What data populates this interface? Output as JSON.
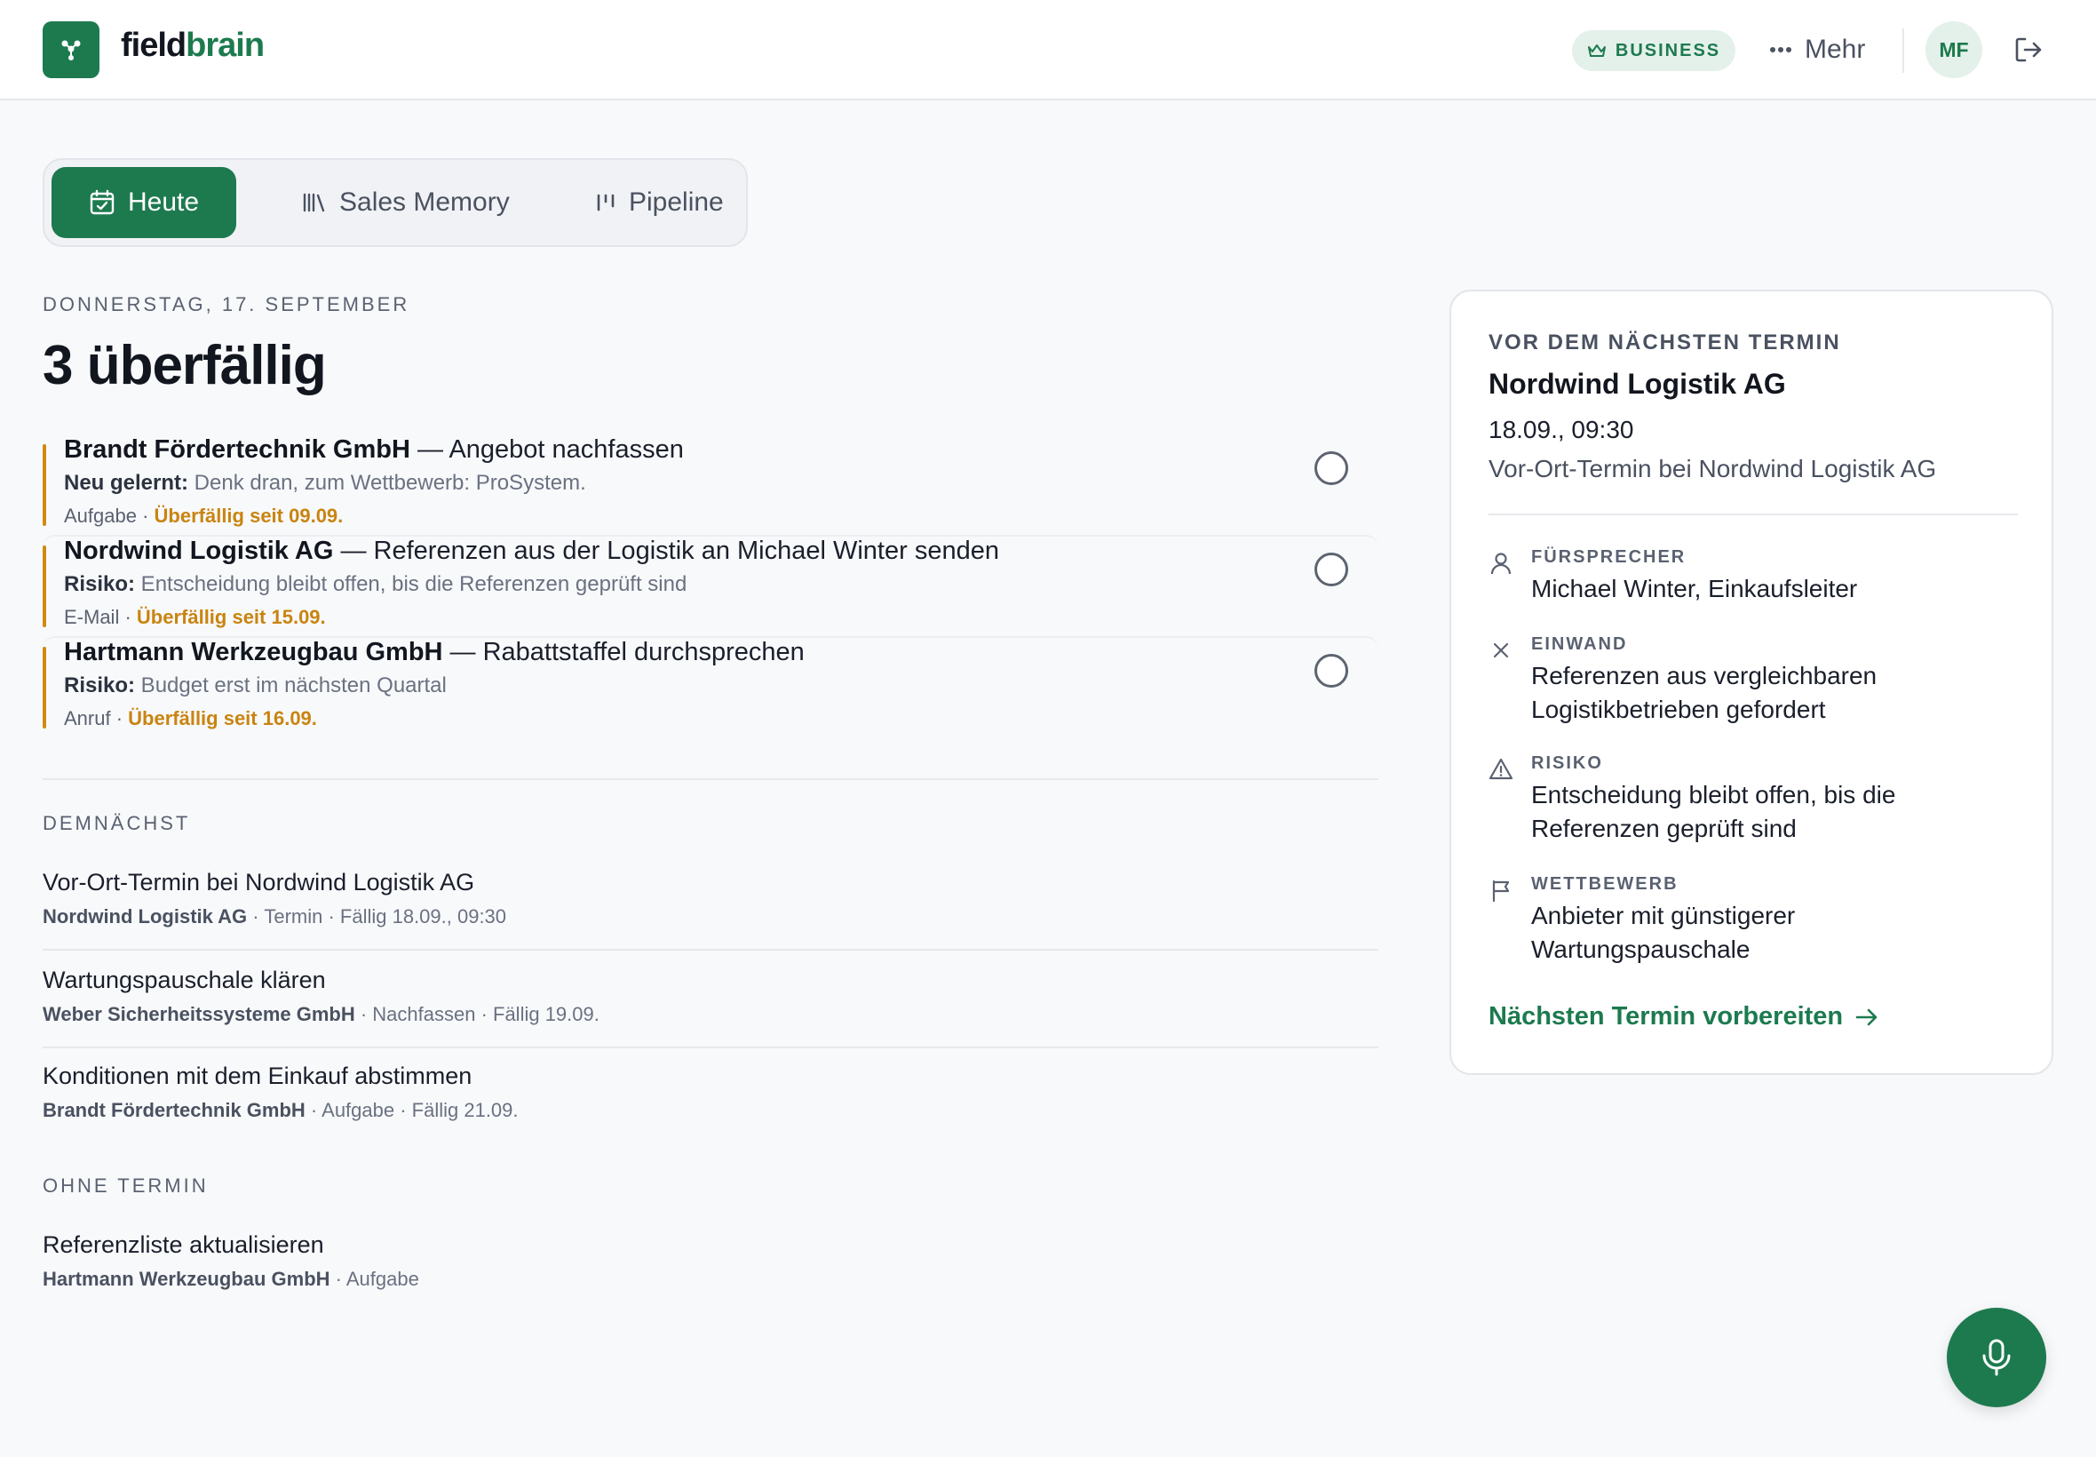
{
  "brand": {
    "part1": "field",
    "part2": "brain"
  },
  "header": {
    "plan_badge": "BUSINESS",
    "more_label": "Mehr",
    "avatar_initials": "MF"
  },
  "tabs": [
    {
      "label": "Heute",
      "icon": "calendar-check-icon",
      "active": true
    },
    {
      "label": "Sales Memory",
      "icon": "library-icon",
      "active": false
    },
    {
      "label": "Pipeline",
      "icon": "pipeline-icon",
      "active": false
    }
  ],
  "date_label": "DONNERSTAG, 17. SEPTEMBER",
  "headline": "3 überfällig",
  "overdue": [
    {
      "company": "Brandt Fördertechnik GmbH",
      "task": " — Angebot nachfassen",
      "note_label": "Neu gelernt:",
      "note": " Denk dran, zum Wettbewerb: ProSystem.",
      "type": "Aufgabe · ",
      "due": "Überfällig seit 09.09."
    },
    {
      "company": "Nordwind Logistik AG",
      "task": " — Referenzen aus der Logistik an Michael Winter senden",
      "note_label": "Risiko:",
      "note": " Entscheidung bleibt offen, bis die Referenzen geprüft sind",
      "type": "E-Mail · ",
      "due": "Überfällig seit 15.09."
    },
    {
      "company": "Hartmann Werkzeugbau GmbH",
      "task": " — Rabattstaffel durchsprechen",
      "note_label": "Risiko:",
      "note": " Budget erst im nächsten Quartal",
      "type": "Anruf · ",
      "due": "Überfällig seit 16.09."
    }
  ],
  "upcoming": {
    "label": "DEMNÄCHST",
    "items": [
      {
        "title": "Vor-Ort-Termin bei Nordwind Logistik AG",
        "company": "Nordwind Logistik AG",
        "meta": " · Termin · Fällig 18.09., 09:30"
      },
      {
        "title": "Wartungspauschale klären",
        "company": "Weber Sicherheitssysteme GmbH",
        "meta": " · Nachfassen · Fällig 19.09."
      },
      {
        "title": "Konditionen mit dem Einkauf abstimmen",
        "company": "Brandt Fördertechnik GmbH",
        "meta": " · Aufgabe · Fällig 21.09."
      }
    ]
  },
  "no_date": {
    "label": "OHNE TERMIN",
    "items": [
      {
        "title": "Referenzliste aktualisieren",
        "company": "Hartmann Werkzeugbau GmbH",
        "meta": " · Aufgabe"
      }
    ]
  },
  "next_meeting": {
    "kicker": "VOR DEM NÄCHSTEN TERMIN",
    "company": "Nordwind Logistik AG",
    "datetime": "18.09., 09:30",
    "description": "Vor-Ort-Termin bei Nordwind Logistik AG",
    "insights": [
      {
        "icon": "person-icon",
        "label": "FÜRSPRECHER",
        "value": "Michael Winter, Einkaufsleiter"
      },
      {
        "icon": "x-icon",
        "label": "EINWAND",
        "value": "Referenzen aus vergleichbaren Logistikbetrieben gefordert"
      },
      {
        "icon": "warning-icon",
        "label": "RISIKO",
        "value": "Entscheidung bleibt offen, bis die Referenzen geprüft sind"
      },
      {
        "icon": "flag-icon",
        "label": "WETTBEWERB",
        "value": "Anbieter mit günstigerer Wartungspauschale"
      }
    ],
    "cta": "Nächsten Termin vorbereiten"
  },
  "colors": {
    "accent": "#1d7a4f",
    "overdue": "#c98410"
  }
}
